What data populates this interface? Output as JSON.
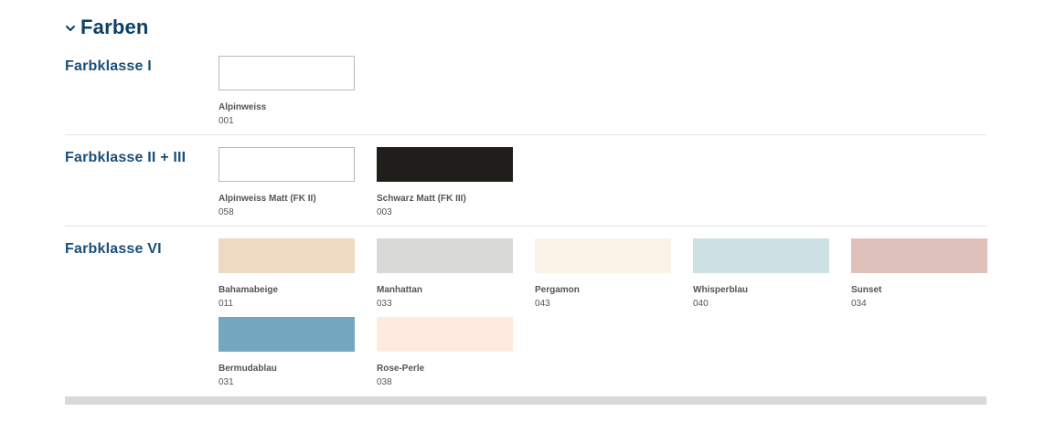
{
  "section": {
    "title": "Farben",
    "expanded": true
  },
  "classes": [
    {
      "label": "Farbklasse I",
      "swatches": [
        {
          "name": "Alpinweiss",
          "code": "001",
          "color": "#ffffff",
          "bordered": true
        }
      ]
    },
    {
      "label": "Farbklasse II + III",
      "swatches": [
        {
          "name": "Alpinweiss Matt (FK II)",
          "code": "058",
          "color": "#ffffff",
          "bordered": true
        },
        {
          "name": "Schwarz Matt (FK III)",
          "code": "003",
          "color": "#1f1e1a",
          "bordered": false
        }
      ]
    },
    {
      "label": "Farbklasse VI",
      "swatches": [
        {
          "name": "Bahamabeige",
          "code": "011",
          "color": "#eedac2",
          "bordered": false
        },
        {
          "name": "Manhattan",
          "code": "033",
          "color": "#d9d9d7",
          "bordered": false
        },
        {
          "name": "Pergamon",
          "code": "043",
          "color": "#faf2e7",
          "bordered": false
        },
        {
          "name": "Whisperblau",
          "code": "040",
          "color": "#cde0e3",
          "bordered": false
        },
        {
          "name": "Sunset",
          "code": "034",
          "color": "#dfc1bb",
          "bordered": false
        },
        {
          "name": "Bermudablau",
          "code": "031",
          "color": "#74a7bf",
          "bordered": false
        },
        {
          "name": "Rose-Perle",
          "code": "038",
          "color": "#fdebdf",
          "bordered": false
        }
      ]
    }
  ],
  "colors": {
    "heading": "#0b3f66",
    "class_label": "#1b4f78",
    "divider": "#e4e4e4",
    "bottom_bar": "#d8d8d8"
  }
}
